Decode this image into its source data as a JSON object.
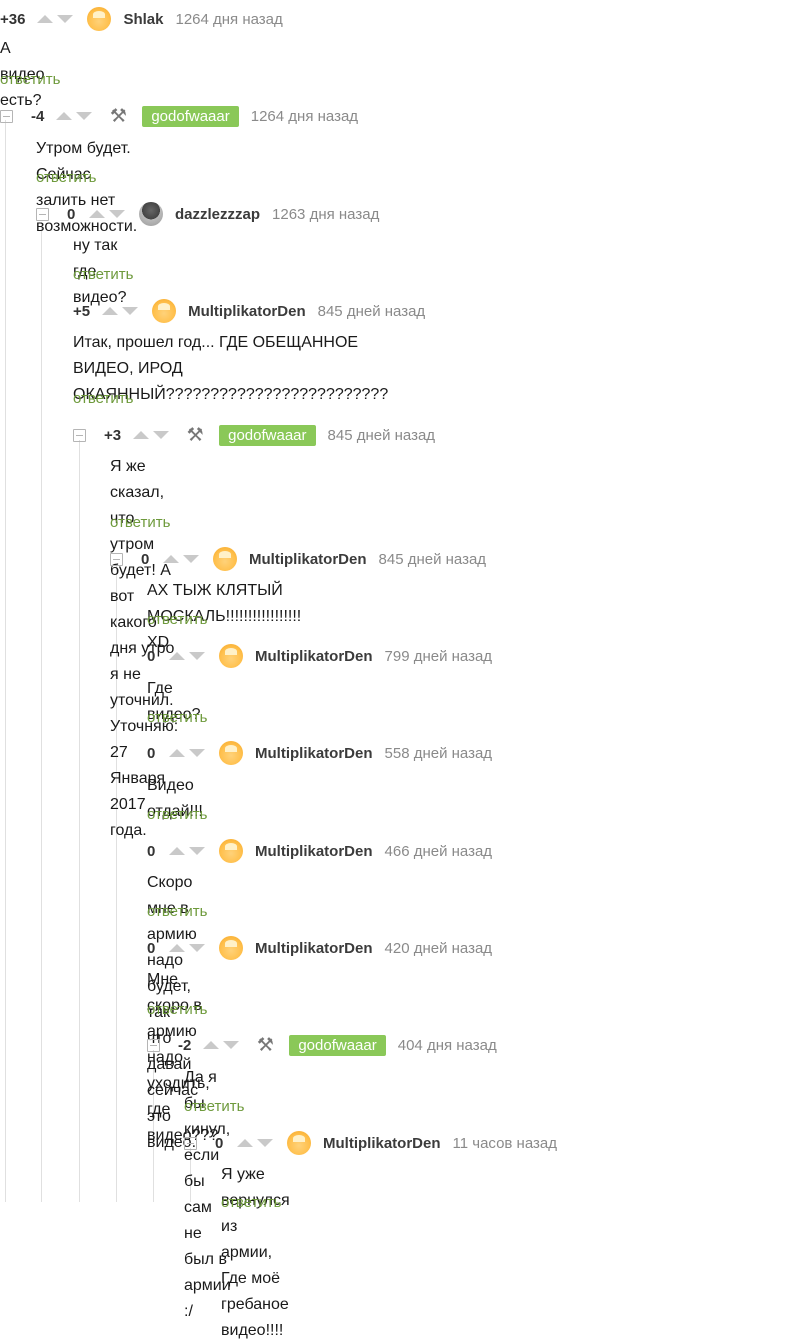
{
  "comments": [
    {
      "rating": "+36",
      "user": "Shlak",
      "time": "1264 дня назад",
      "text": "А видео есть?",
      "reply": "ответить"
    },
    {
      "rating": "-4",
      "user": "godofwaaar",
      "time": "1264 дня назад",
      "text": "Утром будет. Сейчас залить нет возможности.",
      "reply": "ответить"
    },
    {
      "rating": "0",
      "user": "dazzlezzzap",
      "time": "1263 дня назад",
      "text": "ну так где видео?",
      "reply": "ответить"
    },
    {
      "rating": "+5",
      "user": "MultiplikatorDen",
      "time": "845 дней назад",
      "text_line1": "Итак, прошел год... ГДЕ ОБЕЩАННОЕ ВИДЕО, ИРОД",
      "text_line2": "ОКАЯННЫЙ?????????????????????????",
      "reply": "ответить"
    },
    {
      "rating": "+3",
      "user": "godofwaaar",
      "time": "845 дней назад",
      "text_line1": "Я же сказал, что утром будет! А вот какого дня утро я не уточнил. Уточняю: 27",
      "text_line2": "Января 2017 года.",
      "reply": "ответить"
    },
    {
      "rating": "0",
      "user": "MultiplikatorDen",
      "time": "845 дней назад",
      "text": "АХ ТЫЖ КЛЯТЫЙ МОСКАЛЬ!!!!!!!!!!!!!!!!! XD",
      "reply": "ответить"
    },
    {
      "rating": "0",
      "user": "MultiplikatorDen",
      "time": "799 дней назад",
      "text": "Где видео?",
      "reply": "ответить"
    },
    {
      "rating": "0",
      "user": "MultiplikatorDen",
      "time": "558 дней назад",
      "text": "Видео отдай!!!",
      "reply": "ответить"
    },
    {
      "rating": "0",
      "user": "MultiplikatorDen",
      "time": "466 дней назад",
      "text": "Скоро мне в армию надо будет, так что давай сейчас это видео.",
      "reply": "ответить"
    },
    {
      "rating": "0",
      "user": "MultiplikatorDen",
      "time": "420 дней назад",
      "text": "Мне скоро в армию надо уходить, где видео???",
      "reply": "ответить"
    },
    {
      "rating": "-2",
      "user": "godofwaaar",
      "time": "404 дня назад",
      "text": "Да я бы кинул, если бы сам не был в армии :/",
      "reply": "ответить"
    },
    {
      "rating": "0",
      "user": "MultiplikatorDen",
      "time": "11 часов назад",
      "text": "Я уже вернулся из армии, Где моё гребаное видео!!!!",
      "reply": "ответить"
    }
  ],
  "icons": {
    "collapse": "minus-box-icon",
    "upvote": "arrow-up-icon",
    "downvote": "arrow-down-icon",
    "avatar_default": "pikabu-avatar-icon",
    "avatar_tools": "crossed-tools-icon",
    "avatar_mono": "mushroom-avatar-icon"
  },
  "colors": {
    "badge": "#8ac858",
    "reply": "#6e9a3c",
    "time": "#8a8a8a",
    "arrow": "#c9c9c9"
  }
}
